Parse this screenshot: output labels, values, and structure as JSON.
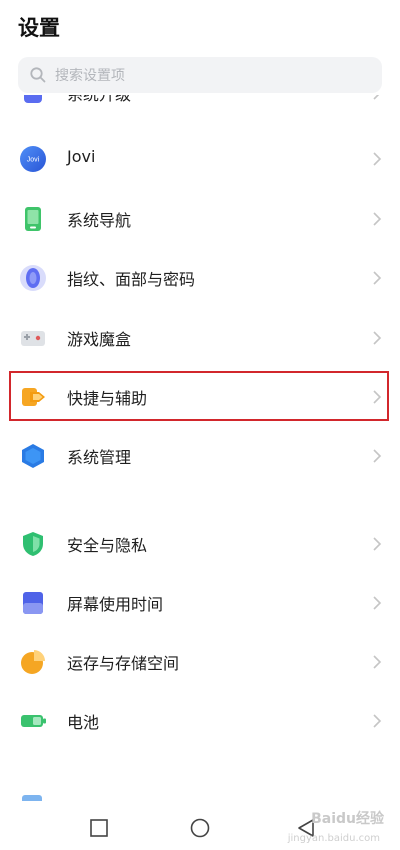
{
  "header": {
    "title": "设置"
  },
  "search": {
    "placeholder": "搜索设置项"
  },
  "top_partial": {
    "label": "系统升级"
  },
  "items": [
    {
      "label": "Jovi",
      "icon": "jovi-icon"
    },
    {
      "label": "系统导航",
      "icon": "phone-navigation-icon"
    },
    {
      "label": "指纹、面部与密码",
      "icon": "fingerprint-icon"
    },
    {
      "label": "游戏魔盒",
      "icon": "game-box-icon"
    },
    {
      "label": "快捷与辅助",
      "icon": "shortcut-arrow-icon",
      "highlighted": true
    },
    {
      "label": "系统管理",
      "icon": "system-hexagon-icon"
    },
    {
      "label": "安全与隐私",
      "icon": "shield-icon"
    },
    {
      "label": "屏幕使用时间",
      "icon": "screen-time-icon"
    },
    {
      "label": "运存与存储空间",
      "icon": "storage-pie-icon"
    },
    {
      "label": "电池",
      "icon": "battery-icon"
    }
  ],
  "highlight_color": "#d2272c",
  "watermark": {
    "text": "Baidu经验",
    "sub": "jingyan.baidu.com"
  },
  "navbar": {
    "buttons": [
      "recents-square-icon",
      "home-circle-icon",
      "back-triangle-icon"
    ]
  }
}
